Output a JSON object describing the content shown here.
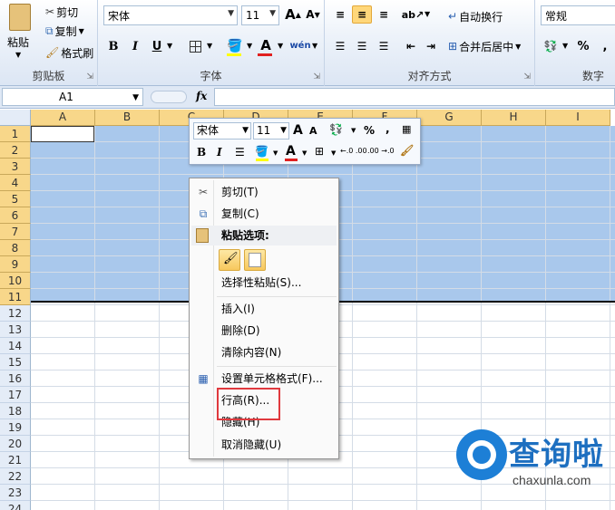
{
  "ribbon": {
    "clipboard": {
      "paste_label": "粘贴",
      "cut_label": "剪切",
      "copy_label": "复制",
      "format_painter_label": "格式刷",
      "group_label": "剪贴板"
    },
    "font": {
      "font_name": "宋体",
      "font_size": "11",
      "grow_font_label": "A",
      "shrink_font_label": "A",
      "bold_label": "B",
      "italic_label": "I",
      "underline_label": "U",
      "font_color_label": "A",
      "phonetic_label": "wén",
      "group_label": "字体"
    },
    "alignment": {
      "wrap_text_label": "自动换行",
      "merge_center_label": "合并后居中",
      "group_label": "对齐方式"
    },
    "number": {
      "format_value": "常规",
      "percent_label": "%",
      "comma_label": ",",
      "group_label": "数字"
    }
  },
  "formula_bar": {
    "name_box_value": "A1",
    "fx_label": "fx",
    "formula_value": ""
  },
  "grid": {
    "columns": [
      "A",
      "B",
      "C",
      "D",
      "E",
      "F",
      "G",
      "H",
      "I"
    ],
    "rows": [
      "1",
      "2",
      "3",
      "4",
      "5",
      "6",
      "7",
      "8",
      "9",
      "10",
      "11",
      "12",
      "13",
      "14",
      "15",
      "16",
      "17",
      "18",
      "19",
      "20",
      "21",
      "22",
      "23",
      "24"
    ],
    "selected_rows": "1-11"
  },
  "mini_toolbar": {
    "font_name": "宋体",
    "font_size": "11",
    "grow_label": "A",
    "shrink_label": "A",
    "percent_label": "%",
    "comma_label": ",",
    "bold_label": "B",
    "italic_label": "I",
    "font_color_label": "A",
    "inc_decimal_label": "←.0 .00",
    "dec_decimal_label": ".00 →.0"
  },
  "context_menu": {
    "items": [
      {
        "label": "剪切(T)",
        "icon": "scissors-icon"
      },
      {
        "label": "复制(C)",
        "icon": "copy-icon"
      },
      {
        "label": "粘贴选项:",
        "icon": "paste-icon",
        "header": true
      },
      {
        "label": "选择性粘贴(S)...",
        "icon": ""
      },
      {
        "label": "插入(I)",
        "icon": ""
      },
      {
        "label": "删除(D)",
        "icon": ""
      },
      {
        "label": "清除内容(N)",
        "icon": ""
      },
      {
        "label": "设置单元格格式(F)...",
        "icon": "format-cells-icon"
      },
      {
        "label": "行高(R)...",
        "icon": "",
        "highlighted": true
      },
      {
        "label": "隐藏(H)",
        "icon": ""
      },
      {
        "label": "取消隐藏(U)",
        "icon": ""
      }
    ]
  },
  "watermark": {
    "title": "查询啦",
    "url": "chaxunla.com"
  },
  "colors": {
    "selection": "#a9c8ec",
    "header_selected": "#f8d78a",
    "highlight_box": "#e0393e",
    "watermark_blue": "#1d7fd6"
  }
}
